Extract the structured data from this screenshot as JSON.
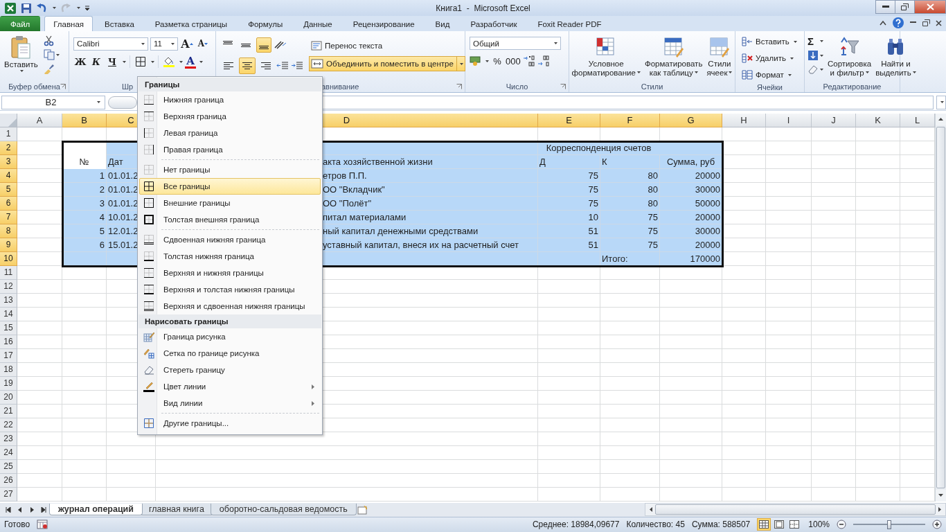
{
  "window": {
    "title": "Книга1  -  Microsoft Excel"
  },
  "ribbon_tabs": [
    {
      "label": "Файл",
      "kind": "file",
      "selected": false
    },
    {
      "label": "Главная",
      "kind": "tab",
      "selected": true
    },
    {
      "label": "Вставка",
      "kind": "tab",
      "selected": false
    },
    {
      "label": "Разметка страницы",
      "kind": "tab",
      "selected": false
    },
    {
      "label": "Формулы",
      "kind": "tab",
      "selected": false
    },
    {
      "label": "Данные",
      "kind": "tab",
      "selected": false
    },
    {
      "label": "Рецензирование",
      "kind": "tab",
      "selected": false
    },
    {
      "label": "Вид",
      "kind": "tab",
      "selected": false
    },
    {
      "label": "Разработчик",
      "kind": "tab",
      "selected": false
    },
    {
      "label": "Foxit Reader PDF",
      "kind": "tab",
      "selected": false
    }
  ],
  "clipboard": {
    "paste": "Вставить",
    "group": "Буфер обмена"
  },
  "font": {
    "name": "Calibri",
    "size": "11",
    "grow": "A",
    "shrink": "A",
    "bold": "Ж",
    "italic": "К",
    "underline": "Ч",
    "color_glyph": "A",
    "group": "Шр"
  },
  "alignment": {
    "vertical": [
      {
        "selected": false
      },
      {
        "selected": false
      },
      {
        "selected": true
      }
    ],
    "horizontal": [
      {
        "selected": false
      },
      {
        "selected": true
      },
      {
        "selected": false
      }
    ],
    "wrap": "Перенос текста",
    "merge": {
      "label": "Объединить и поместить в центре",
      "selected": true
    },
    "group": "авнивание"
  },
  "number": {
    "format": "Общий",
    "percent": "%",
    "thousands": "000",
    "group": "Число"
  },
  "styles": {
    "buttons": [
      {
        "line1": "Условное",
        "line2": "форматирование"
      },
      {
        "line1": "Форматировать",
        "line2": "как таблицу"
      },
      {
        "line1": "Стили",
        "line2": "ячеек"
      }
    ],
    "group": "Стили"
  },
  "cells_group": {
    "buttons": [
      "Вставить",
      "Удалить",
      "Формат"
    ],
    "group": "Ячейки"
  },
  "editing": {
    "sum": "Σ",
    "buttons": [
      {
        "line1": "Сортировка",
        "line2": "и фильтр"
      },
      {
        "line1": "Найти и",
        "line2": "выделить"
      }
    ],
    "group": "Редактирование"
  },
  "formula_bar": {
    "name_box": "B2"
  },
  "columns": [
    {
      "label": "A",
      "selected": false
    },
    {
      "label": "B",
      "selected": true
    },
    {
      "label": "C",
      "selected": true
    },
    {
      "label": "D",
      "selected": true
    },
    {
      "label": "E",
      "selected": true
    },
    {
      "label": "F",
      "selected": true
    },
    {
      "label": "G",
      "selected": true
    },
    {
      "label": "H",
      "selected": false
    },
    {
      "label": "I",
      "selected": false
    },
    {
      "label": "J",
      "selected": false
    },
    {
      "label": "K",
      "selected": false
    },
    {
      "label": "L",
      "selected": false
    }
  ],
  "rows": [
    {
      "header": "1",
      "selected": false,
      "cells": {}
    },
    {
      "header": "2",
      "selected": true,
      "cells": {
        "B": {
          "active": true
        },
        "E": {
          "text": "Корреспонденция счетов",
          "kind": "heading",
          "merged": true
        }
      }
    },
    {
      "header": "3",
      "selected": true,
      "cells": {
        "B": {
          "text": "№",
          "kind": "heading",
          "active": true
        },
        "C": {
          "text": "Дат",
          "kind": "text"
        },
        "D": {
          "text": "акта хозяйственной жизни",
          "kind": "text"
        },
        "E": {
          "text": "Д",
          "kind": "text"
        },
        "F": {
          "text": "К",
          "kind": "text"
        },
        "G": {
          "text": "Сумма, руб",
          "kind": "heading"
        }
      }
    },
    {
      "header": "4",
      "selected": true,
      "cells": {
        "B": {
          "text": "1",
          "kind": "number"
        },
        "C": {
          "text": "01.01.2",
          "kind": "text"
        },
        "D": {
          "text": "етров П.П.",
          "kind": "text"
        },
        "E": {
          "text": "75",
          "kind": "number"
        },
        "F": {
          "text": "80",
          "kind": "number"
        },
        "G": {
          "text": "20000",
          "kind": "number"
        }
      }
    },
    {
      "header": "5",
      "selected": true,
      "cells": {
        "B": {
          "text": "2",
          "kind": "number"
        },
        "C": {
          "text": "01.01.2",
          "kind": "text"
        },
        "D": {
          "text": "ОО \"Вкладчик\"",
          "kind": "text"
        },
        "E": {
          "text": "75",
          "kind": "number"
        },
        "F": {
          "text": "80",
          "kind": "number"
        },
        "G": {
          "text": "30000",
          "kind": "number"
        }
      }
    },
    {
      "header": "6",
      "selected": true,
      "cells": {
        "B": {
          "text": "3",
          "kind": "number"
        },
        "C": {
          "text": "01.01.2",
          "kind": "text"
        },
        "D": {
          "text": "ОО \"Полёт\"",
          "kind": "text"
        },
        "E": {
          "text": "75",
          "kind": "number"
        },
        "F": {
          "text": "80",
          "kind": "number"
        },
        "G": {
          "text": "50000",
          "kind": "number"
        }
      }
    },
    {
      "header": "7",
      "selected": true,
      "cells": {
        "B": {
          "text": "4",
          "kind": "number"
        },
        "C": {
          "text": "10.01.2",
          "kind": "text"
        },
        "D": {
          "text": "питал материалами",
          "kind": "text"
        },
        "E": {
          "text": "10",
          "kind": "number"
        },
        "F": {
          "text": "75",
          "kind": "number"
        },
        "G": {
          "text": "20000",
          "kind": "number"
        }
      }
    },
    {
      "header": "8",
      "selected": true,
      "cells": {
        "B": {
          "text": "5",
          "kind": "number"
        },
        "C": {
          "text": "12.01.2",
          "kind": "text"
        },
        "D": {
          "text": "ный капитал денежными средствами",
          "kind": "text"
        },
        "E": {
          "text": "51",
          "kind": "number"
        },
        "F": {
          "text": "75",
          "kind": "number"
        },
        "G": {
          "text": "30000",
          "kind": "number"
        }
      }
    },
    {
      "header": "9",
      "selected": true,
      "cells": {
        "B": {
          "text": "6",
          "kind": "number"
        },
        "C": {
          "text": "15.01.2",
          "kind": "text"
        },
        "D": {
          "text": "уставный капитал, внеся их на расчетный счет",
          "kind": "text"
        },
        "E": {
          "text": "51",
          "kind": "number"
        },
        "F": {
          "text": "75",
          "kind": "number"
        },
        "G": {
          "text": "20000",
          "kind": "number"
        }
      }
    },
    {
      "header": "10",
      "selected": true,
      "cells": {
        "F": {
          "text": "Итого:",
          "kind": "text"
        },
        "G": {
          "text": "170000",
          "kind": "number"
        }
      }
    },
    {
      "header": "11",
      "selected": false,
      "cells": {}
    },
    {
      "header": "12",
      "selected": false,
      "cells": {}
    },
    {
      "header": "13",
      "selected": false,
      "cells": {}
    },
    {
      "header": "14",
      "selected": false,
      "cells": {}
    },
    {
      "header": "15",
      "selected": false,
      "cells": {}
    },
    {
      "header": "16",
      "selected": false,
      "cells": {}
    },
    {
      "header": "17",
      "selected": false,
      "cells": {}
    },
    {
      "header": "18",
      "selected": false,
      "cells": {}
    },
    {
      "header": "19",
      "selected": false,
      "cells": {}
    },
    {
      "header": "20",
      "selected": false,
      "cells": {}
    },
    {
      "header": "21",
      "selected": false,
      "cells": {}
    },
    {
      "header": "22",
      "selected": false,
      "cells": {}
    },
    {
      "header": "23",
      "selected": false,
      "cells": {}
    },
    {
      "header": "24",
      "selected": false,
      "cells": {}
    },
    {
      "header": "25",
      "selected": false,
      "cells": {}
    },
    {
      "header": "26",
      "selected": false,
      "cells": {}
    },
    {
      "header": "27",
      "selected": false,
      "cells": {}
    }
  ],
  "borders_menu": {
    "sections": [
      {
        "title": "Границы",
        "groups": [
          [
            {
              "label": "Нижняя граница",
              "selected": false
            },
            {
              "label": "Верхняя граница",
              "selected": false
            },
            {
              "label": "Левая граница",
              "selected": false
            },
            {
              "label": "Правая граница",
              "selected": false
            }
          ],
          [
            {
              "label": "Нет границы",
              "selected": false
            },
            {
              "label": "Все границы",
              "selected": true
            },
            {
              "label": "Внешние границы",
              "selected": false
            },
            {
              "label": "Толстая внешняя граница",
              "selected": false
            }
          ],
          [
            {
              "label": "Сдвоенная нижняя граница",
              "selected": false
            },
            {
              "label": "Толстая нижняя граница",
              "selected": false
            },
            {
              "label": "Верхняя и нижняя границы",
              "selected": false
            },
            {
              "label": "Верхняя и толстая нижняя границы",
              "selected": false
            },
            {
              "label": "Верхняя и сдвоенная нижняя границы",
              "selected": false
            }
          ]
        ]
      },
      {
        "title": "Нарисовать границы",
        "groups": [
          [
            {
              "label": "Граница рисунка",
              "selected": false
            },
            {
              "label": "Сетка по границе рисунка",
              "selected": false
            },
            {
              "label": "Стереть границу",
              "selected": false
            },
            {
              "label": "Цвет линии",
              "selected": false,
              "submenu": true
            },
            {
              "label": "Вид линии",
              "selected": false,
              "submenu": true
            }
          ],
          [
            {
              "label": "Другие границы...",
              "selected": false
            }
          ]
        ]
      }
    ]
  },
  "sheet_tabs": [
    {
      "label": "журнал операций",
      "selected": true
    },
    {
      "label": "главная книга",
      "selected": false
    },
    {
      "label": "оборотно-сальдовая ведомость",
      "selected": false
    }
  ],
  "status_bar": {
    "ready": "Готово",
    "average": "Среднее: 18984,09677",
    "count": "Количество: 45",
    "sum": "Сумма: 588507",
    "zoom": "100%",
    "zoom_level": {
      "level": 0.5
    },
    "views": [
      {
        "selected": true
      },
      {
        "selected": false
      },
      {
        "selected": false
      }
    ]
  }
}
